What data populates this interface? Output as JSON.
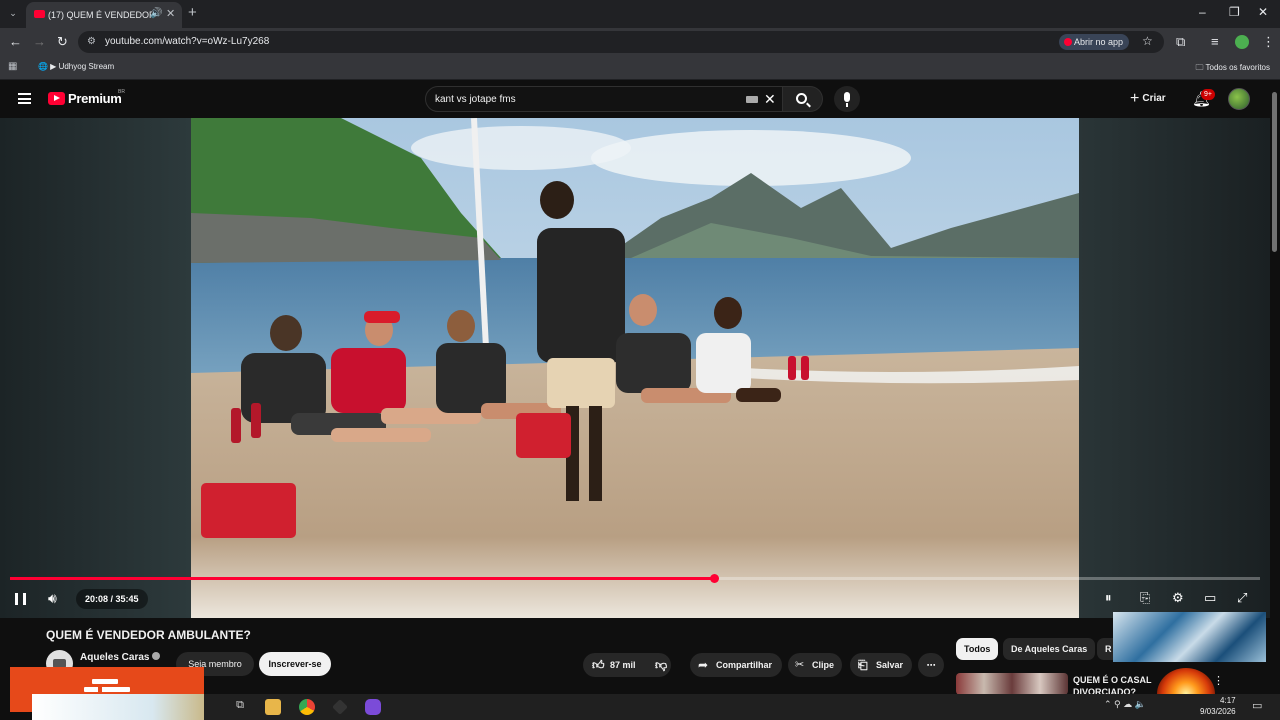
{
  "browser": {
    "tab_title": "(17) QUEM É VENDEDOR AMBULANTE?",
    "url": "youtube.com/watch?v=oWz-Lu7y268",
    "open_app_label": "Abrir no app",
    "bookmark_label": "Udhyog Stream",
    "favorites_label": "Todos os favoritos"
  },
  "youtube": {
    "logo_text": "Premium",
    "logo_country": "BR",
    "search_query": "kant vs jotape fms",
    "create_label": "Criar",
    "notification_count": "9+"
  },
  "player": {
    "current_time": "20:08",
    "duration": "35:45",
    "time_display": "20:08 / 35:45",
    "progress_fraction": 0.563
  },
  "video": {
    "title": "QUEM É VENDEDOR AMBULANTE?",
    "channel_name": "Aqueles Caras",
    "member_label": "Seja membro",
    "subscribe_label": "Inscrever-se",
    "likes": "87 mil",
    "share_label": "Compartilhar",
    "clip_label": "Clipe",
    "save_label": "Salvar"
  },
  "recommendations": {
    "chips": [
      "Todos",
      "De Aqueles Caras",
      "R"
    ],
    "first_title": "QUEM É O CASAL DIVORCIADO?"
  },
  "taskbar": {
    "time": "4:17",
    "date": "9/03/2026"
  },
  "colors": {
    "accent": "#ff0033",
    "background": "#0f0f0f",
    "overlay_orange": "#e6491a"
  }
}
